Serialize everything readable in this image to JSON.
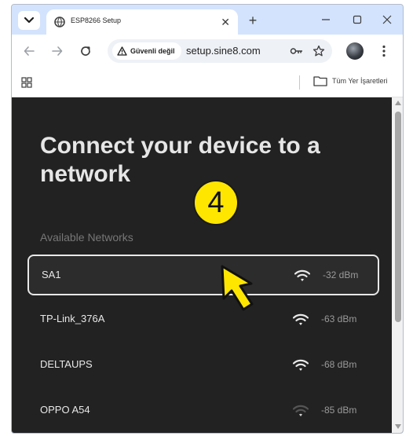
{
  "browser": {
    "tab": {
      "title": "ESP8266 Setup",
      "close_glyph": "✕"
    },
    "new_tab_glyph": "+",
    "window_controls": {
      "minimize": "—",
      "maximize": "☐",
      "close": "✕"
    },
    "address_bar": {
      "security_warning": "Güvenli değil",
      "url": "setup.sine8.com"
    },
    "bookmarks_bar": {
      "all_bookmarks_label": "Tüm Yer İşaretleri"
    }
  },
  "page": {
    "title": "Connect your device to a network",
    "step_number": "4",
    "section_label": "Available Networks",
    "networks": [
      {
        "ssid": "SA1",
        "signal": "-32 dBm",
        "selected": true,
        "strength": "full"
      },
      {
        "ssid": "TP-Link_376A",
        "signal": "-63 dBm",
        "selected": false,
        "strength": "full"
      },
      {
        "ssid": "DELTAUPS",
        "signal": "-68 dBm",
        "selected": false,
        "strength": "full"
      },
      {
        "ssid": "OPPO A54",
        "signal": "-85 dBm",
        "selected": false,
        "strength": "weak"
      }
    ]
  },
  "colors": {
    "page_background": "#222222",
    "title_text": "#e6e6e6",
    "badge_yellow": "#ffe600",
    "cursor_yellow": "#ffe600",
    "browser_chrome": "#d3e3fd"
  },
  "icons": {
    "tab_menu": "chevron-down-icon",
    "favicon": "globe-icon",
    "back": "arrow-left-icon",
    "forward": "arrow-right-icon",
    "reload": "reload-icon",
    "warning": "warning-triangle-icon",
    "password": "key-icon",
    "bookmark": "star-icon",
    "menu": "kebab-menu-icon",
    "apps": "apps-grid-icon",
    "folder": "folder-icon",
    "wifi": "wifi-icon",
    "pointer": "arrow-cursor-icon"
  }
}
